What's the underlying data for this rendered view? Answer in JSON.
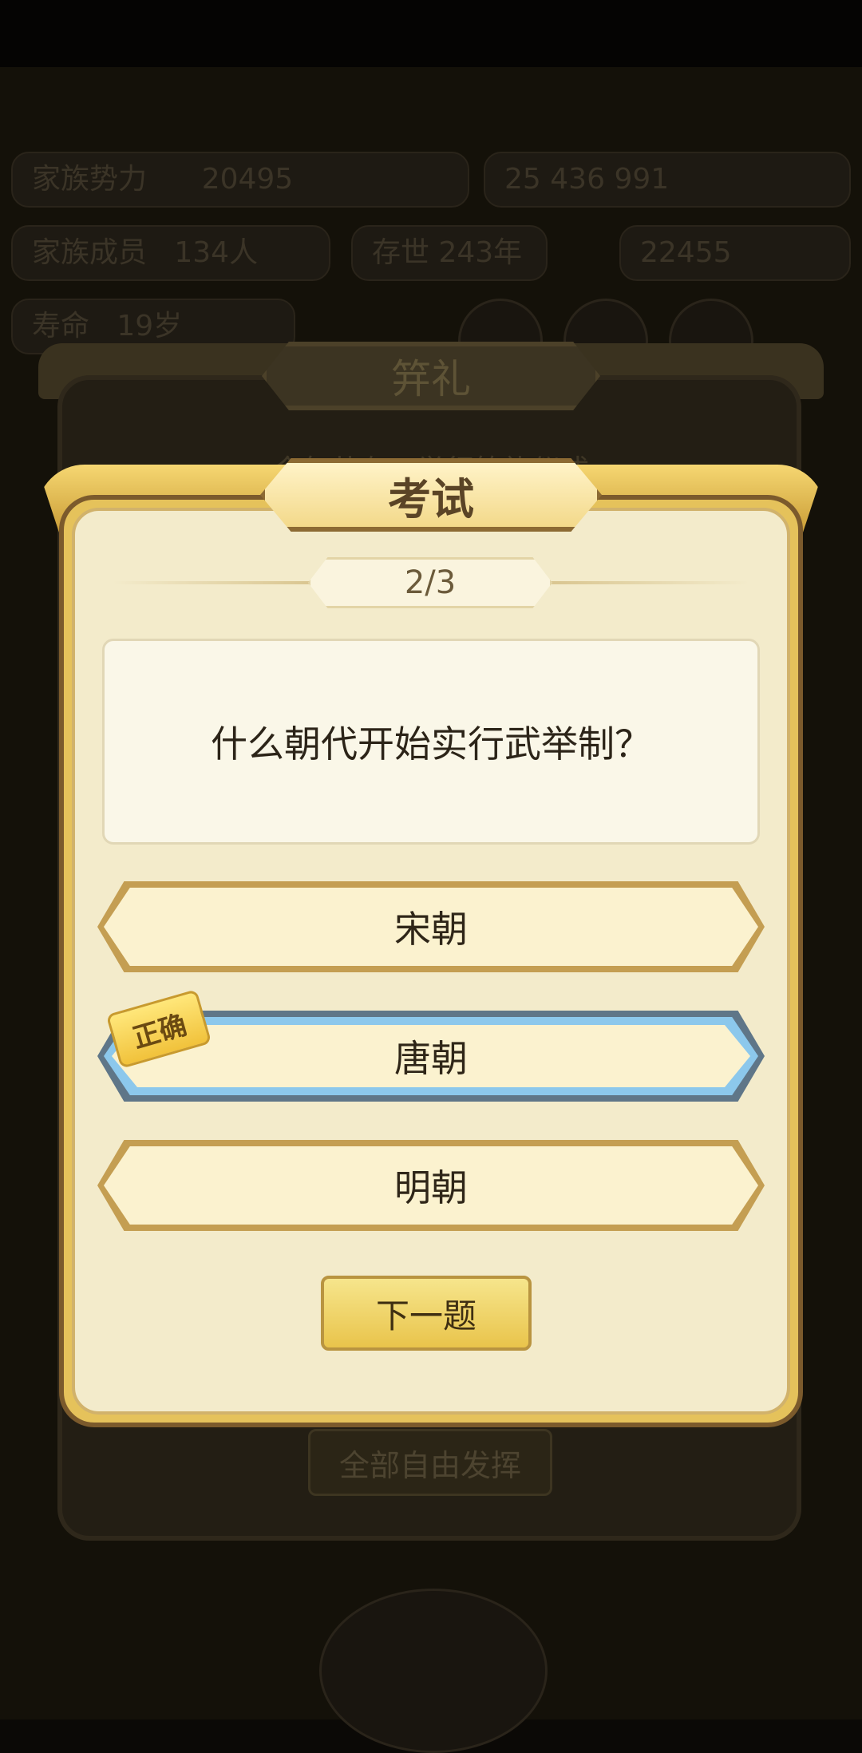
{
  "background": {
    "stats": [
      "家族势力",
      "20495",
      "25",
      "436",
      "991",
      "家族成员",
      "134人",
      "存世",
      "243年",
      "22455",
      "寿命",
      "19岁"
    ],
    "back_dialog": {
      "title": "笄礼",
      "subtitle": "今年共有…举行笄礼仪式",
      "button": "全部自由发挥"
    }
  },
  "dialog": {
    "title": "考试",
    "progress": "2/3",
    "question": "什么朝代开始实行武举制？",
    "options": [
      {
        "label": "宋朝",
        "state": "normal"
      },
      {
        "label": "唐朝",
        "state": "correct"
      },
      {
        "label": "明朝",
        "state": "normal"
      }
    ],
    "correct_badge": "正确",
    "next_button": "下一题"
  },
  "colors": {
    "panel": "#f3ebcb",
    "gold": "#e5c25b",
    "correct_border": "#8cc8ec",
    "button": "#e9c44b"
  }
}
